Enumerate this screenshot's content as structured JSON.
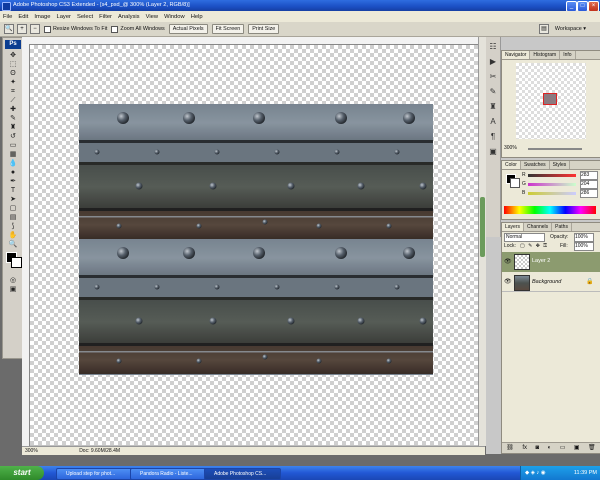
{
  "window": {
    "title": "Adobe Photoshop CS3 Extended - [s4_psd_@ 300% (Layer 2, RGB/8)]",
    "controls": {
      "minimize": "_",
      "maximize": "□",
      "close": "×"
    }
  },
  "menu": [
    "File",
    "Edit",
    "Image",
    "Layer",
    "Select",
    "Filter",
    "Analysis",
    "View",
    "Window",
    "Help"
  ],
  "options": {
    "resize_windows": "Resize Windows To Fit",
    "zoom_all": "Zoom All Windows",
    "actual_pixels": "Actual Pixels",
    "fit_screen": "Fit Screen",
    "print_size": "Print Size",
    "workspace": "Workspace ▾"
  },
  "tools": {
    "logo": "Ps"
  },
  "status": {
    "zoom": "300%",
    "doc": "Doc: 9.60M/28.4M"
  },
  "navigator": {
    "tabs": [
      "Navigator",
      "Histogram",
      "Info"
    ],
    "zoom": "300%"
  },
  "color": {
    "tabs": [
      "Color",
      "Swatches",
      "Styles"
    ],
    "r_label": "R",
    "r": "283",
    "g_label": "G",
    "g": "204",
    "b_label": "B",
    "b": "286"
  },
  "layers": {
    "tabs": [
      "Layers",
      "Channels",
      "Paths"
    ],
    "mode": "Normal",
    "opacity_label": "Opacity:",
    "opacity": "100%",
    "lock_label": "Lock:",
    "fill_label": "Fill:",
    "fill": "100%",
    "items": [
      {
        "name": "Layer 2",
        "selected": true
      },
      {
        "name": "Background",
        "selected": false
      }
    ]
  },
  "taskbar": {
    "start": "start",
    "tasks": [
      "Upload step for phot...",
      "Pandora Radio - Liste...",
      "Adobe Photoshop CS..."
    ],
    "clock": "11:39 PM"
  },
  "colors": {
    "accent": "#2257d4",
    "layer_selected": "#8c9b6f",
    "start_green": "#3f9c3a"
  }
}
